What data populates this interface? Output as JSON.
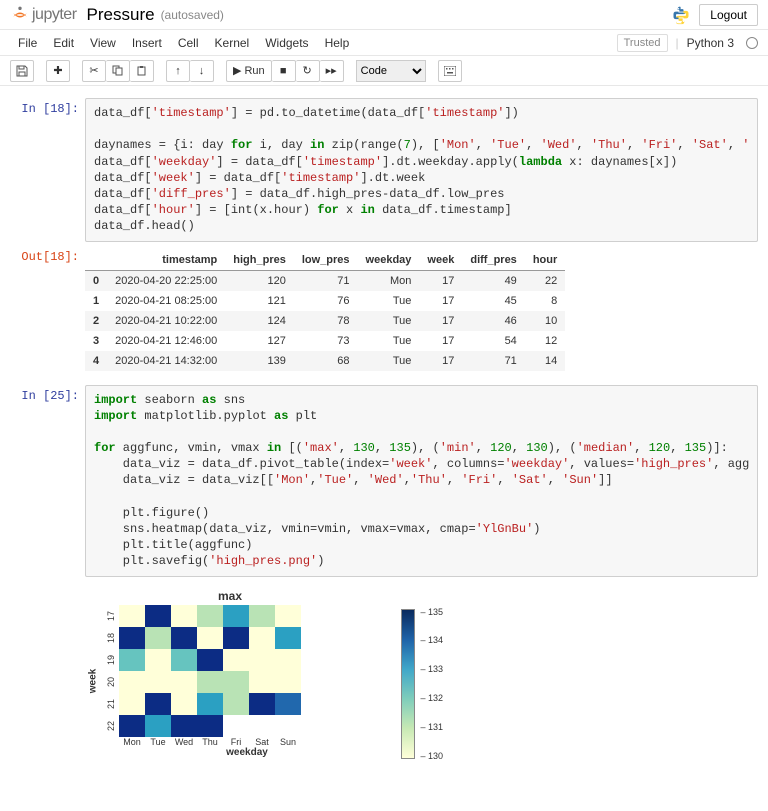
{
  "header": {
    "logo_text": "jupyter",
    "notebook_name": "Pressure",
    "autosave": "(autosaved)",
    "logout": "Logout"
  },
  "menubar": {
    "items": [
      "File",
      "Edit",
      "View",
      "Insert",
      "Cell",
      "Kernel",
      "Widgets",
      "Help"
    ],
    "trusted": "Trusted",
    "kernel": "Python 3"
  },
  "toolbar": {
    "run_label": "Run",
    "cell_type": "Code"
  },
  "cells": {
    "c0": {
      "in_prompt": "In [18]:",
      "out_prompt": "Out[18]:",
      "code_html": "data_df[<span class='c-str'>'timestamp'</span>] = pd.to_datetime(data_df[<span class='c-str'>'timestamp'</span>])\n\ndaynames = {i: day <span class='c-kw'>for</span> i, day <span class='c-kw'>in</span> zip(range(<span class='c-num'>7</span>), [<span class='c-str'>'Mon'</span>, <span class='c-str'>'Tue'</span>, <span class='c-str'>'Wed'</span>, <span class='c-str'>'Thu'</span>, <span class='c-str'>'Fri'</span>, <span class='c-str'>'Sat'</span>, <span class='c-str'>'Sun'</span>])}\ndata_df[<span class='c-str'>'weekday'</span>] = data_df[<span class='c-str'>'timestamp'</span>].dt.weekday.apply(<span class='c-kw'>lambda</span> x: daynames[x])\ndata_df[<span class='c-str'>'week'</span>] = data_df[<span class='c-str'>'timestamp'</span>].dt.week\ndata_df[<span class='c-str'>'diff_pres'</span>] = data_df.high_pres-data_df.low_pres\ndata_df[<span class='c-str'>'hour'</span>] = [int(x.hour) <span class='c-kw'>for</span> x <span class='c-kw'>in</span> data_df.timestamp]\ndata_df.head()"
    },
    "c1": {
      "in_prompt": "In [25]:",
      "code_html": "<span class='c-kw'>import</span> seaborn <span class='c-kw'>as</span> sns\n<span class='c-kw'>import</span> matplotlib.pyplot <span class='c-kw'>as</span> plt\n\n<span class='c-kw'>for</span> aggfunc, vmin, vmax <span class='c-kw'>in</span> [(<span class='c-str'>'max'</span>, <span class='c-num'>130</span>, <span class='c-num'>135</span>), (<span class='c-str'>'min'</span>, <span class='c-num'>120</span>, <span class='c-num'>130</span>), (<span class='c-str'>'median'</span>, <span class='c-num'>120</span>, <span class='c-num'>135</span>)]:\n    data_viz = data_df.pivot_table(index=<span class='c-str'>'week'</span>, columns=<span class='c-str'>'weekday'</span>, values=<span class='c-str'>'high_pres'</span>, aggfunc=aggfunc)\n    data_viz = data_viz[[<span class='c-str'>'Mon'</span>,<span class='c-str'>'Tue'</span>, <span class='c-str'>'Wed'</span>,<span class='c-str'>'Thu'</span>, <span class='c-str'>'Fri'</span>, <span class='c-str'>'Sat'</span>, <span class='c-str'>'Sun'</span>]]\n\n    plt.figure()\n    sns.heatmap(data_viz, vmin=vmin, vmax=vmax, cmap=<span class='c-str'>'YlGnBu'</span>)\n    plt.title(aggfunc)\n    plt.savefig(<span class='c-str'>'high_pres.png'</span>)"
    }
  },
  "dataframe": {
    "columns": [
      "",
      "timestamp",
      "high_pres",
      "low_pres",
      "weekday",
      "week",
      "diff_pres",
      "hour"
    ],
    "rows": [
      [
        "0",
        "2020-04-20 22:25:00",
        "120",
        "71",
        "Mon",
        "17",
        "49",
        "22"
      ],
      [
        "1",
        "2020-04-21 08:25:00",
        "121",
        "76",
        "Tue",
        "17",
        "45",
        "8"
      ],
      [
        "2",
        "2020-04-21 10:22:00",
        "124",
        "78",
        "Tue",
        "17",
        "46",
        "10"
      ],
      [
        "3",
        "2020-04-21 12:46:00",
        "127",
        "73",
        "Tue",
        "17",
        "54",
        "12"
      ],
      [
        "4",
        "2020-04-21 14:32:00",
        "139",
        "68",
        "Tue",
        "17",
        "71",
        "14"
      ]
    ]
  },
  "chart_data": {
    "type": "heatmap",
    "title": "max",
    "xlabel": "weekday",
    "ylabel": "week",
    "x_categories": [
      "Mon",
      "Tue",
      "Wed",
      "Thu",
      "Fri",
      "Sat",
      "Sun"
    ],
    "y_categories": [
      "17",
      "18",
      "19",
      "20",
      "21",
      "22"
    ],
    "vmin": 130,
    "vmax": 135,
    "colormap": "YlGnBu",
    "colorbar_ticks": [
      135,
      134,
      133,
      132,
      131,
      130
    ],
    "values": [
      [
        130,
        135,
        130,
        131,
        133,
        131,
        130
      ],
      [
        135,
        131,
        135,
        130,
        135,
        130,
        133
      ],
      [
        132,
        130,
        132,
        135,
        130,
        130,
        130
      ],
      [
        130,
        130,
        130,
        131,
        131,
        130,
        130
      ],
      [
        130,
        135,
        130,
        133,
        131,
        135,
        134
      ],
      [
        135,
        133,
        135,
        135,
        null,
        null,
        null
      ]
    ]
  }
}
